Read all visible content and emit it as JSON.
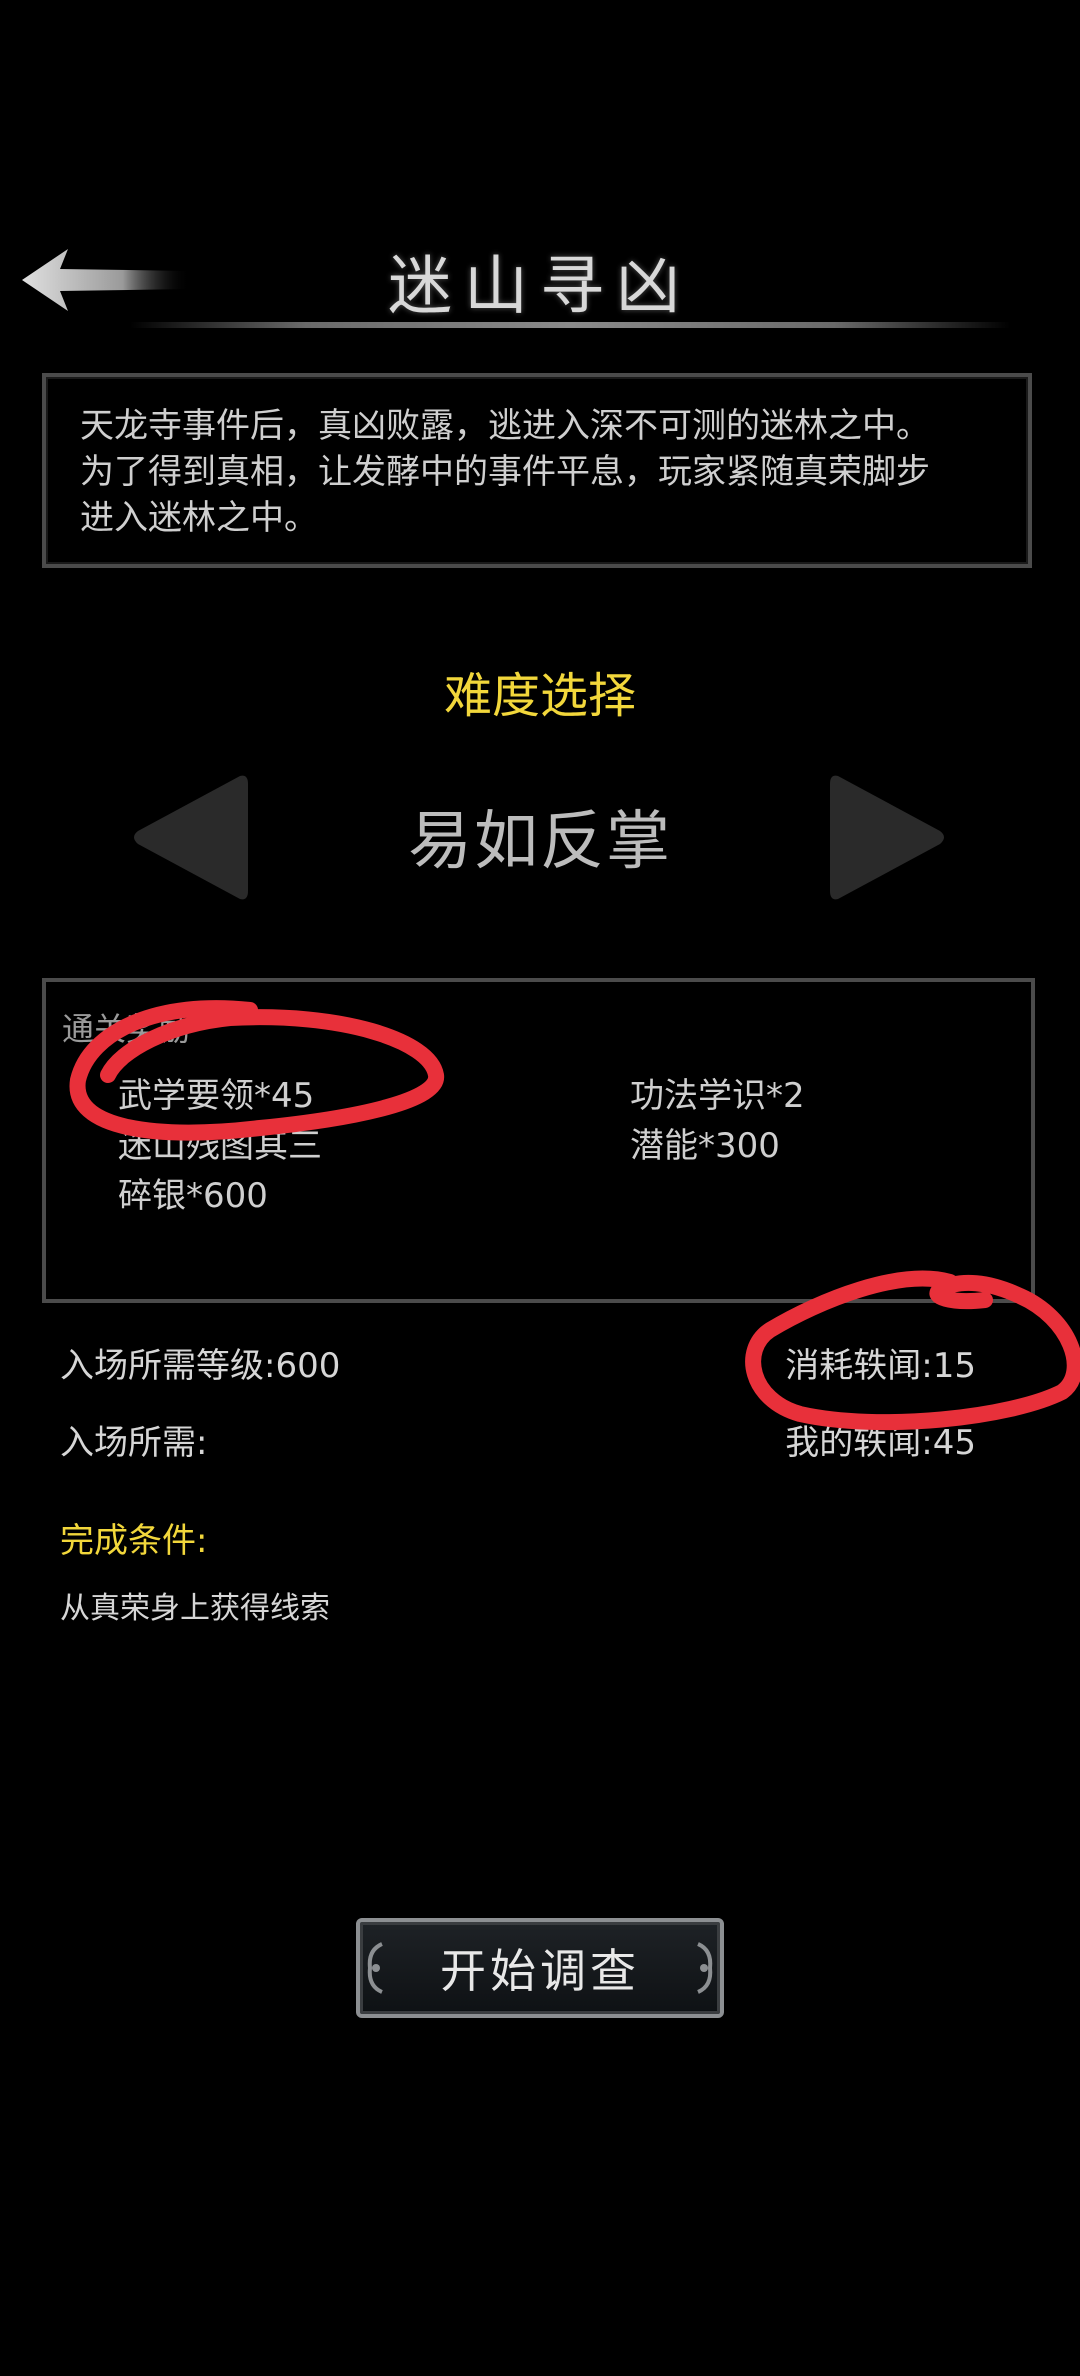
{
  "header": {
    "title": "迷山寻凶",
    "back_icon": "back-arrow-icon"
  },
  "description": "天龙寺事件后，真凶败露，逃进入深不可测的迷林之中。\n为了得到真相，让发酵中的事件平息，玩家紧随真荣脚步\n进入迷林之中。",
  "difficulty": {
    "label": "难度选择",
    "value": "易如反掌",
    "prev_icon": "triangle-left-icon",
    "next_icon": "triangle-right-icon"
  },
  "rewards": {
    "title": "通关奖励",
    "items": [
      "武学要领*45",
      "功法学识*2",
      "迷山残图其三",
      "潜能*300",
      "碎银*600"
    ]
  },
  "requirements": {
    "level": "入场所需等级:600",
    "cost": "消耗轶闻:15",
    "entry": "入场所需:",
    "owned": "我的轶闻:45"
  },
  "completion": {
    "label": "完成条件:",
    "text": "从真荣身上获得线索"
  },
  "start_button": {
    "label": "开始调查"
  },
  "colors": {
    "accent_yellow": "#f2d73b",
    "markup_red": "#e8303a",
    "background": "#000000"
  }
}
